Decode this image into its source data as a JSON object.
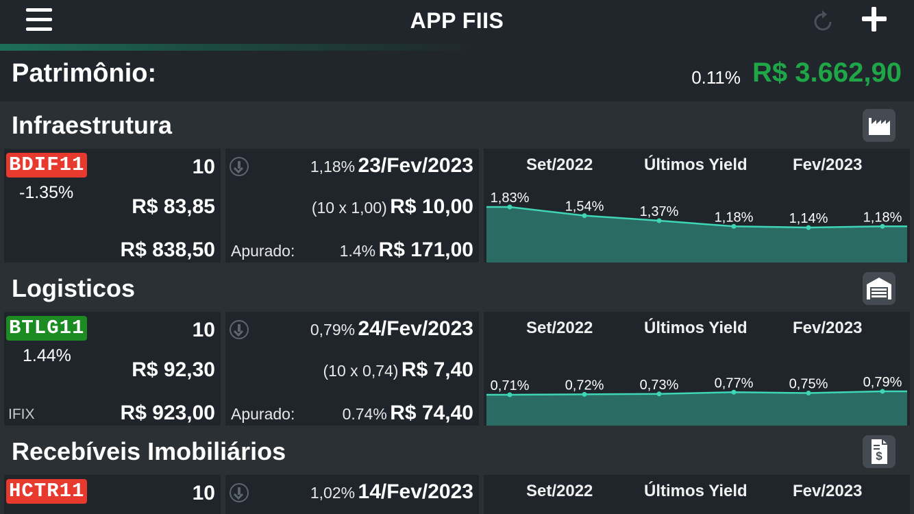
{
  "app": {
    "title": "APP FIIS"
  },
  "icons": {
    "menu": "hamburger-menu-icon",
    "refresh": "refresh-icon",
    "add": "plus-icon"
  },
  "patrimonio": {
    "label": "Patrimônio:",
    "change": "0.11%",
    "value": "R$ 3.662,90",
    "value_color": "#1fa647"
  },
  "colors": {
    "ticker_down": "#e8392f",
    "ticker_up": "#1b8b22",
    "chart_line": "#3fd6b8",
    "chart_fill": "#2a6b63"
  },
  "sections": [
    {
      "title": "Infraestrutura",
      "icon": "factory-icon",
      "fund": {
        "ticker": "BDIF11",
        "trend": "down",
        "change": "-1.35%",
        "qty": "10",
        "price": "R$ 83,85",
        "total": "R$ 838,50",
        "tag": "",
        "div_yield": "1,18%",
        "div_date": "23/Fev/2023",
        "div_calc": "(10 x 1,00)",
        "div_value": "R$ 10,00",
        "apurado_label": "Apurado:",
        "apurado_pct": "1.4%",
        "apurado_value": "R$ 171,00"
      },
      "chart": {
        "left_label": "Set/2022",
        "mid_label": "Últimos Yield",
        "right_label": "Fev/2023",
        "point_labels": [
          "1,83%",
          "1,54%",
          "1,37%",
          "1,18%",
          "1,14%",
          "1,18%"
        ],
        "values": [
          1.83,
          1.54,
          1.37,
          1.18,
          1.14,
          1.18
        ]
      }
    },
    {
      "title": "Logisticos",
      "icon": "warehouse-icon",
      "fund": {
        "ticker": "BTLG11",
        "trend": "up",
        "change": "1.44%",
        "qty": "10",
        "price": "R$ 92,30",
        "total": "R$ 923,00",
        "tag": "IFIX",
        "div_yield": "0,79%",
        "div_date": "24/Fev/2023",
        "div_calc": "(10 x 0,74)",
        "div_value": "R$ 7,40",
        "apurado_label": "Apurado:",
        "apurado_pct": "0.74%",
        "apurado_value": "R$ 74,40"
      },
      "chart": {
        "left_label": "Set/2022",
        "mid_label": "Últimos Yield",
        "right_label": "Fev/2023",
        "point_labels": [
          "0,71%",
          "0,72%",
          "0,73%",
          "0,77%",
          "0,75%",
          "0,79%"
        ],
        "values": [
          0.71,
          0.72,
          0.73,
          0.77,
          0.75,
          0.79
        ]
      }
    },
    {
      "title": "Recebíveis Imobiliários",
      "icon": "invoice-dollar-icon",
      "fund": {
        "ticker": "HCTR11",
        "trend": "down",
        "change": "",
        "qty": "10",
        "price": "",
        "total": "",
        "tag": "",
        "div_yield": "1,02%",
        "div_date": "14/Fev/2023",
        "div_calc": "",
        "div_value": "",
        "apurado_label": "",
        "apurado_pct": "",
        "apurado_value": ""
      },
      "chart": {
        "left_label": "Set/2022",
        "mid_label": "Últimos Yield",
        "right_label": "Fev/2023",
        "point_labels": [],
        "values": []
      }
    }
  ]
}
